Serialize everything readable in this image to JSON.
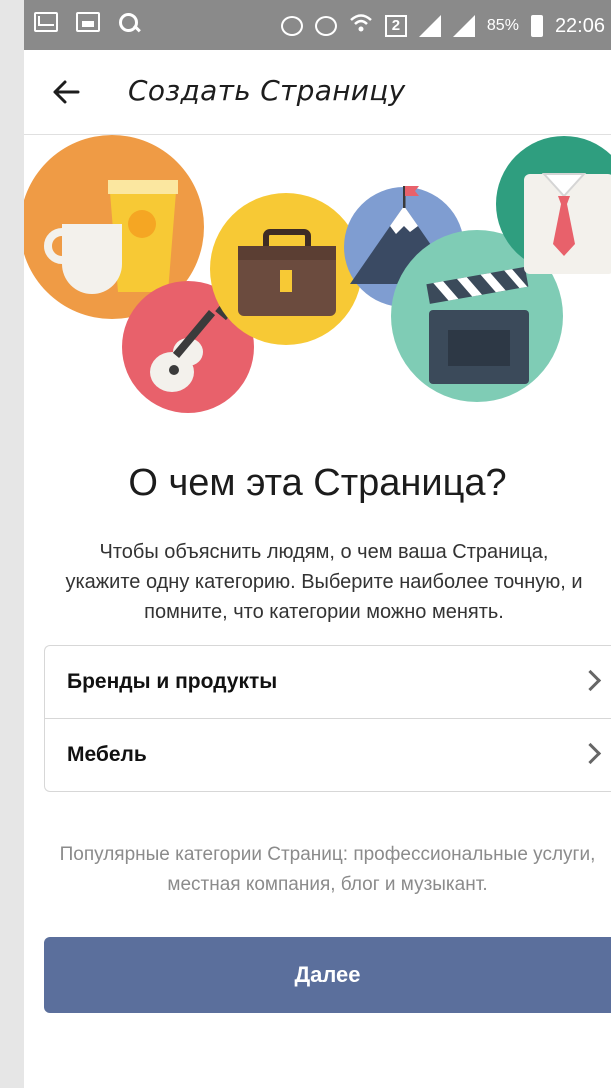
{
  "status_bar": {
    "battery_percent": "85%",
    "time": "22:06",
    "sim_badge": "2",
    "icons": [
      "mail-icon",
      "image-icon",
      "search-icon",
      "mute-icon",
      "alarm-icon",
      "wifi-icon",
      "signal-icon",
      "battery-icon"
    ]
  },
  "app_bar": {
    "title": "Создать Страницу",
    "back_icon": "arrow-left-icon"
  },
  "illustration": {
    "items": [
      "coffee-cups",
      "briefcase",
      "guitar",
      "mountain-flag",
      "clapperboard",
      "shirt-tie"
    ]
  },
  "main": {
    "heading": "О чем эта Страница?",
    "description": "Чтобы объяснить людям, о чем ваша Страница, укажите одну категорию. Выберите наиболее точную, и помните, что категории можно менять.",
    "categories": [
      {
        "label": "Бренды и продукты"
      },
      {
        "label": "Мебель"
      }
    ],
    "hint": "Популярные категории Страниц: профессиональные услуги, местная компания, блог и музыкант.",
    "next_button": "Далее"
  },
  "colors": {
    "button": "#5b6f9c",
    "status_bar": "#8a8a8a",
    "circle_orange": "#ef9b45",
    "circle_yellow": "#f7c935",
    "circle_pink": "#e8616b",
    "circle_blue": "#7f9dd1",
    "circle_teal": "#7fccb5",
    "circle_green": "#2f9e7f"
  }
}
